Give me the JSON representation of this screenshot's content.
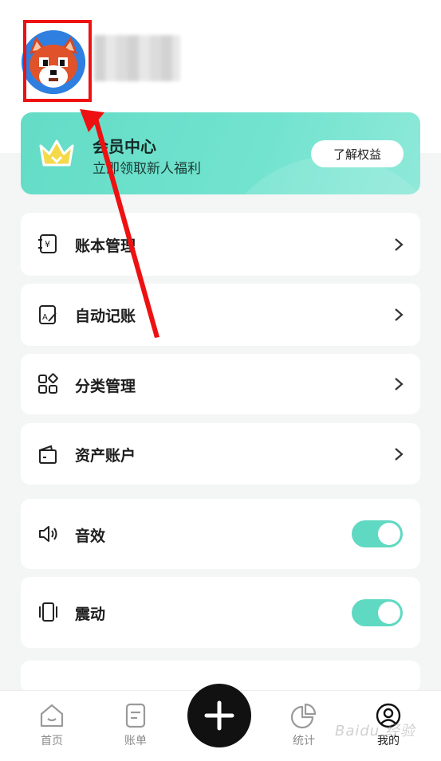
{
  "profile": {
    "avatar_icon": "fox-avatar-icon"
  },
  "vip": {
    "title": "会员中心",
    "subtitle": "立即领取新人福利",
    "button_label": "了解权益",
    "accent_color": "#66ddc8"
  },
  "menu": {
    "items": [
      {
        "label": "账本管理",
        "icon": "ledger-yen-icon",
        "control": "chevron"
      },
      {
        "label": "自动记账",
        "icon": "auto-record-icon",
        "control": "chevron"
      },
      {
        "label": "分类管理",
        "icon": "category-grid-icon",
        "control": "chevron"
      },
      {
        "label": "资产账户",
        "icon": "wallet-icon",
        "control": "chevron"
      },
      {
        "label": "音效",
        "icon": "speaker-icon",
        "control": "toggle",
        "on": true
      },
      {
        "label": "震动",
        "icon": "vibration-phone-icon",
        "control": "toggle",
        "on": true
      }
    ]
  },
  "nav": {
    "items": [
      {
        "label": "首页",
        "icon": "home-icon",
        "active": false
      },
      {
        "label": "账单",
        "icon": "bill-icon",
        "active": false
      },
      {
        "label": "统计",
        "icon": "pie-chart-icon",
        "active": false
      },
      {
        "label": "我的",
        "icon": "profile-icon",
        "active": true
      }
    ],
    "add_icon": "plus-icon"
  },
  "watermark": "Baidu 经验",
  "annotation": {
    "highlight_color": "#ee1111"
  }
}
